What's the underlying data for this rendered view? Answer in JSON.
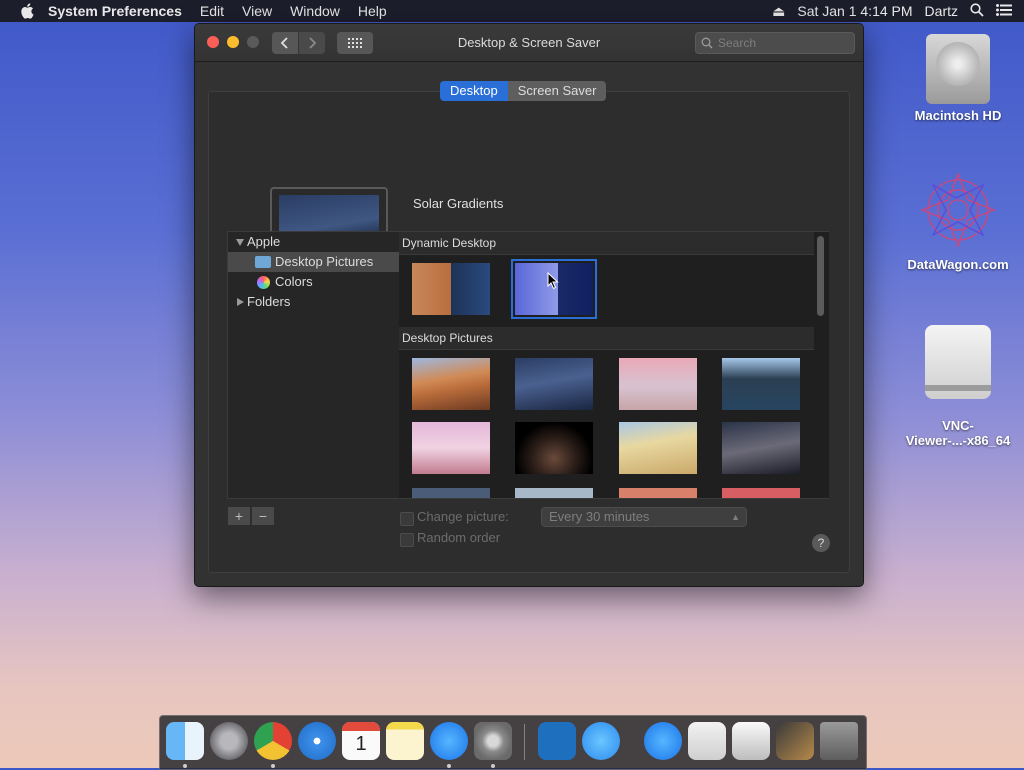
{
  "menubar": {
    "app": "System Preferences",
    "items": [
      "Edit",
      "View",
      "Window",
      "Help"
    ],
    "datetime": "Sat Jan 1  4:14 PM",
    "user": "Dartz"
  },
  "window": {
    "title": "Desktop & Screen Saver",
    "search_placeholder": "Search",
    "tabs": [
      {
        "label": "Desktop",
        "active": true
      },
      {
        "label": "Screen Saver",
        "active": false
      }
    ],
    "preview_name": "Solar Gradients",
    "sidebar": {
      "apple_group": "Apple",
      "desktop_pictures": "Desktop Pictures",
      "colors": "Colors",
      "folders": "Folders"
    },
    "gallery": {
      "dynamic_heading": "Dynamic Desktop",
      "pictures_heading": "Desktop Pictures"
    },
    "controls": {
      "plus": "+",
      "minus": "−",
      "change_picture": "Change picture:",
      "interval": "Every 30 minutes",
      "random_order": "Random order",
      "help": "?"
    }
  },
  "desktop_icons": [
    {
      "label": "Macintosh HD",
      "icon": "hard-drive-icon"
    },
    {
      "label": "DataWagon.com",
      "icon": "mandala-icon"
    },
    {
      "label": "VNC-\nViewer-...-x86_64",
      "icon": "disk-image-icon"
    }
  ],
  "dock": [
    "Finder",
    "Launchpad",
    "Chrome",
    "Safari",
    "Calendar",
    "Notes",
    "App Store",
    "System Preferences",
    "VNC Viewer",
    "Messages",
    "App Store",
    "Preview",
    "Screenshot",
    "Photos",
    "Trash"
  ],
  "calendar_day": "1",
  "colors": {
    "accent": "#2a6ed8"
  }
}
